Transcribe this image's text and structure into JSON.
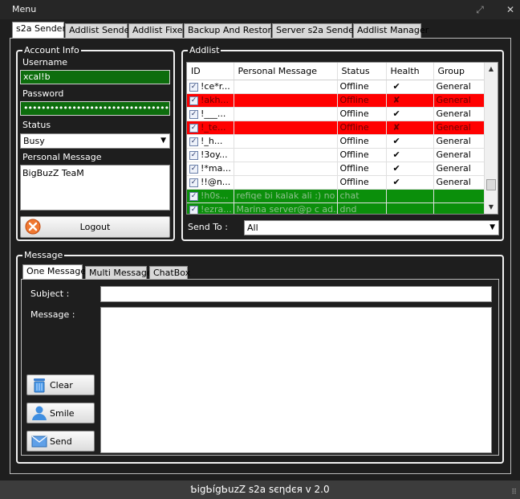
{
  "window": {
    "title": "Menu",
    "footer": "ƄigƄígƄuzZ s2a sєηdєя v 2.0",
    "minimize_glyph": "⤢",
    "close_glyph": "✕"
  },
  "tabs": [
    "s2a Sender",
    "Addlist Sender",
    "Addlist Fixer",
    "Backup And Restore",
    "Server s2a Sender",
    "Addlist Manager"
  ],
  "account": {
    "legend": "Account Info",
    "username_label": "Username",
    "username_value": "xcal!b",
    "password_label": "Password",
    "password_value": "••••••••••••••••••••••••••••••••••••••••••",
    "status_label": "Status",
    "status_value": "Busy",
    "personal_message_label": "Personal Message",
    "personal_message_value": "BigBuzZ TeaM",
    "logout_label": "Logout"
  },
  "addlist": {
    "legend": "Addlist",
    "columns": [
      "ID",
      "Personal Message",
      "Status",
      "Health",
      "Group"
    ],
    "rows": [
      {
        "id": "!ce*r...",
        "pm": "",
        "status": "Offline",
        "health": "✔",
        "group": "General",
        "color": "white"
      },
      {
        "id": "!akh...",
        "pm": "",
        "status": "Offline",
        "health": "✘",
        "group": "General",
        "color": "red"
      },
      {
        "id": "!___...",
        "pm": "",
        "status": "Offline",
        "health": "✔",
        "group": "General",
        "color": "white"
      },
      {
        "id": "!_te...",
        "pm": "",
        "status": "Offline",
        "health": "✘",
        "group": "General",
        "color": "red"
      },
      {
        "id": "!_h...",
        "pm": "",
        "status": "Offline",
        "health": "✔",
        "group": "General",
        "color": "white"
      },
      {
        "id": "!3oy...",
        "pm": "",
        "status": "Offline",
        "health": "✔",
        "group": "General",
        "color": "white"
      },
      {
        "id": "!*ma...",
        "pm": "",
        "status": "Offline",
        "health": "✔",
        "group": "General",
        "color": "white"
      },
      {
        "id": "!!@n...",
        "pm": "",
        "status": "Offline",
        "health": "✔",
        "group": "General",
        "color": "white"
      },
      {
        "id": "!h0s...",
        "pm": "refiqe bi kalak ali :) no ...",
        "status": "chat",
        "health": "",
        "group": "",
        "color": "green"
      },
      {
        "id": "!ezra...",
        "pm": "Marina server@p c ad...",
        "status": "dnd",
        "health": "",
        "group": "",
        "color": "green"
      }
    ],
    "send_to_label": "Send To :",
    "send_to_value": "All"
  },
  "message": {
    "legend": "Message",
    "tabs": [
      "One Message",
      "Multi Message",
      "ChatBox"
    ],
    "subject_label": "Subject :",
    "message_label": "Message :",
    "clear_label": "Clear",
    "smile_label": "Smile",
    "send_label": "Send"
  },
  "colors": {
    "background": "#1e1e1e",
    "field_green": "#0d6d0d",
    "row_red": "#ff0000",
    "row_green": "#0b8f0b"
  }
}
